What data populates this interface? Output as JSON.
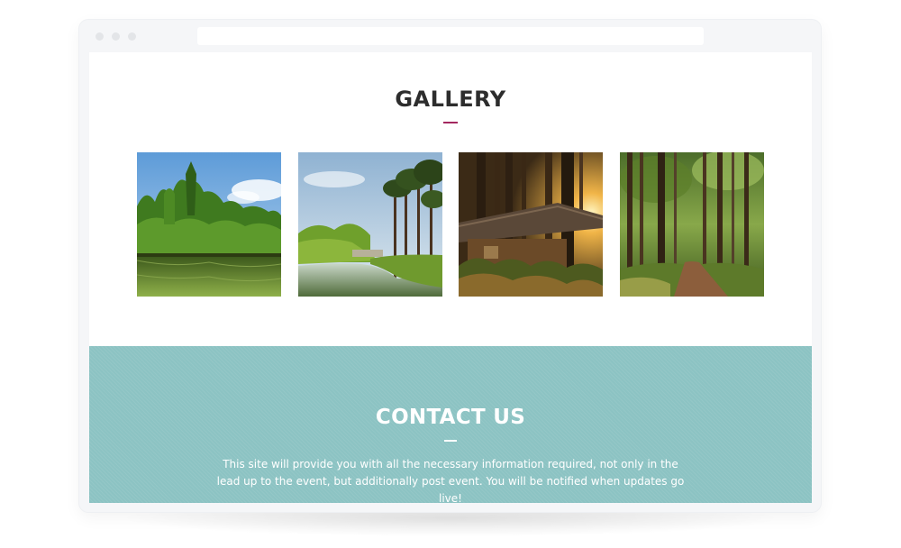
{
  "gallery": {
    "title": "GALLERY",
    "accent_color": "#a3285f",
    "images": [
      {
        "subject": "lake-with-green-trees"
      },
      {
        "subject": "river-bend-with-pines"
      },
      {
        "subject": "woodland-cabin-at-sunset"
      },
      {
        "subject": "forest-path"
      }
    ]
  },
  "contact": {
    "title": "CONTACT US",
    "background_color": "#8cc3c3",
    "text": "This site will provide you with all the necessary information required, not only in the lead up to the event, but additionally post event. You will be notified when updates go live!"
  }
}
